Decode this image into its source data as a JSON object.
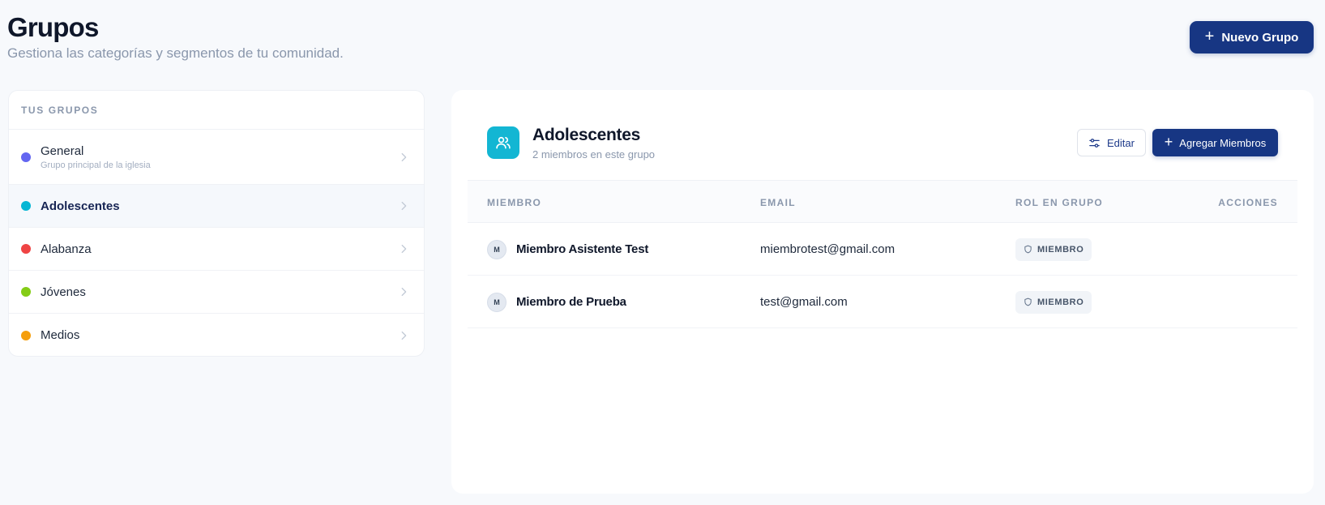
{
  "header": {
    "title": "Grupos",
    "subtitle": "Gestiona las categorías y segmentos de tu comunidad.",
    "new_group_label": "Nuevo Grupo"
  },
  "groups": {
    "heading": "TUS GRUPOS",
    "items": [
      {
        "name": "General",
        "description": "Grupo principal de la iglesia",
        "color": "#6366f1",
        "active": false
      },
      {
        "name": "Adolescentes",
        "description": "",
        "color": "#06b6d4",
        "active": true
      },
      {
        "name": "Alabanza",
        "description": "",
        "color": "#ef4444",
        "active": false
      },
      {
        "name": "Jóvenes",
        "description": "",
        "color": "#84cc16",
        "active": false
      },
      {
        "name": "Medios",
        "description": "",
        "color": "#f59e0b",
        "active": false
      }
    ]
  },
  "detail": {
    "title": "Adolescentes",
    "subtitle": "2 miembros en este grupo",
    "edit_label": "Editar",
    "add_members_label": "Agregar Miembros",
    "columns": {
      "member": "MIEMBRO",
      "email": "EMAIL",
      "role": "ROL EN GRUPO",
      "actions": "ACCIONES"
    },
    "members": [
      {
        "initial": "M",
        "name": "Miembro Asistente Test",
        "email": "miembrotest@gmail.com",
        "role": "MIEMBRO"
      },
      {
        "initial": "M",
        "name": "Miembro de Prueba",
        "email": "test@gmail.com",
        "role": "MIEMBRO"
      }
    ]
  },
  "colors": {
    "primary": "#173683",
    "accent_cyan": "#13b6d3",
    "muted_text": "#8a97ac"
  }
}
